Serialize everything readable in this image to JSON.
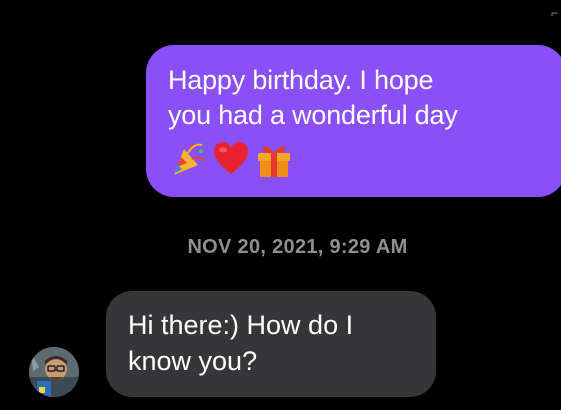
{
  "conversation": {
    "outgoing": {
      "lines": [
        "Happy birthday. I hope",
        "you had a wonderful day"
      ],
      "emojis": [
        "party-popper-emoji",
        "red-heart-emoji",
        "wrapped-gift-emoji"
      ],
      "bubble_color": "#8a4ff7"
    },
    "timestamp": "NOV 20, 2021, 9:29 AM",
    "incoming": {
      "lines": [
        "Hi there:) How do I",
        "know you?"
      ],
      "bubble_color": "#363638"
    },
    "avatar_icon": "contact-avatar"
  }
}
